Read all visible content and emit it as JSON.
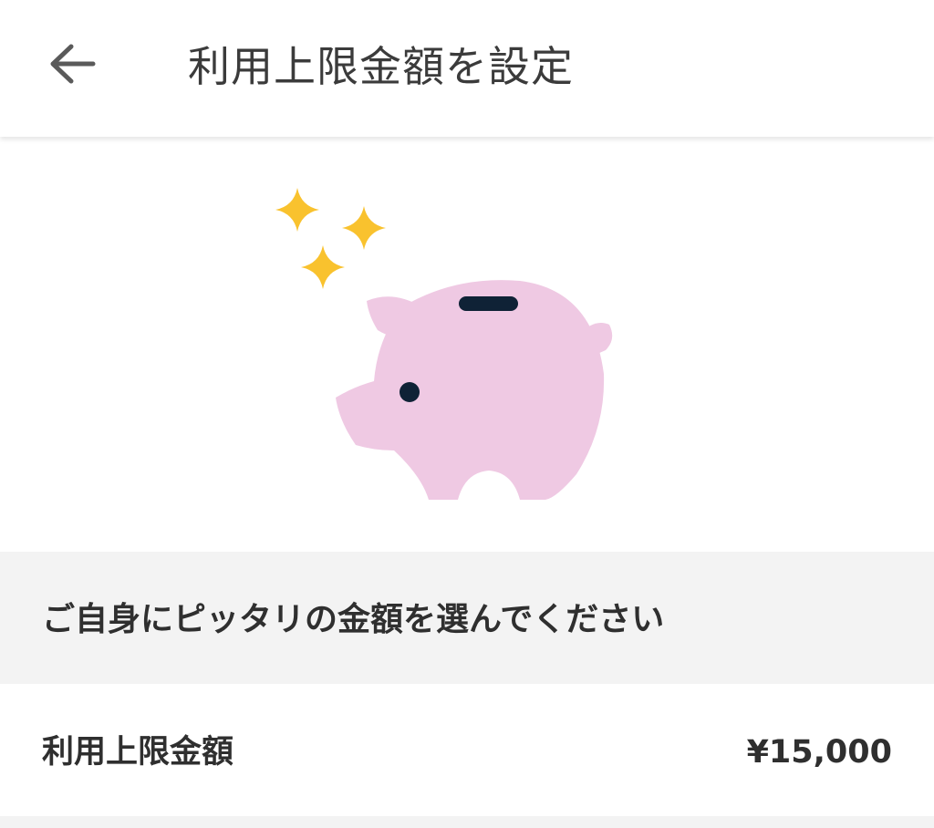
{
  "header": {
    "title": "利用上限金額を設定",
    "back_icon": "arrow-left-icon"
  },
  "illustration": {
    "subject": "piggy-bank-icon",
    "accent_icon": "sparkle-icon",
    "colors": {
      "pig": "#efc9e3",
      "sparkle": "#f9c22e",
      "detail": "#0f2236"
    }
  },
  "section": {
    "instruction": "ご自身にピッタリの金額を選んでください"
  },
  "limit": {
    "label": "利用上限金額",
    "value": "¥15,000"
  },
  "colors": {
    "background": "#ffffff",
    "section_background": "#f3f3f3",
    "text": "#2f2f2f"
  }
}
